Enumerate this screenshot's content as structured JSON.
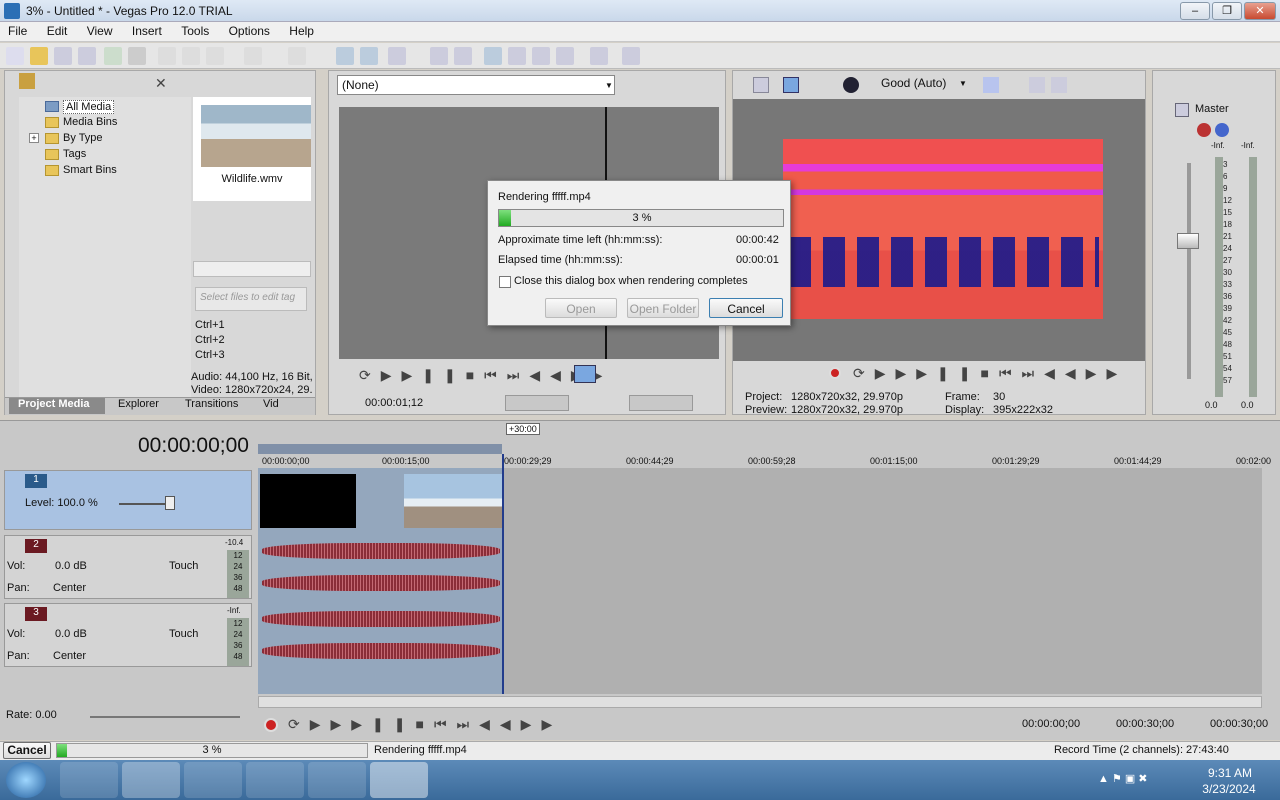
{
  "window": {
    "title": "3% - Untitled * - Vegas Pro 12.0 TRIAL",
    "min": "–",
    "max": "❐",
    "close": "✕"
  },
  "menu": [
    "File",
    "Edit",
    "View",
    "Insert",
    "Tools",
    "Options",
    "Help"
  ],
  "explorer": {
    "tree": [
      "All Media",
      "Media Bins",
      "By Type",
      "Tags",
      "Smart Bins"
    ],
    "expander": "+",
    "thumb_label": "Wildlife.wmv",
    "search_placeholder": "Select files to edit tag",
    "shortcuts": [
      "Ctrl+1",
      "Ctrl+2",
      "Ctrl+3"
    ],
    "info_audio": "Audio: 44,100 Hz, 16 Bit,",
    "info_video": "Video: 1280x720x24, 29.",
    "tabs": [
      "Project Media",
      "Explorer",
      "Transitions",
      "Vid"
    ]
  },
  "trimmer": {
    "select_value": "(None)",
    "timecode": "00:00:01;12"
  },
  "preview": {
    "quality": "Good (Auto)",
    "project_label": "Project:",
    "project_value": "1280x720x32, 29.970p",
    "preview_label": "Preview:",
    "preview_value": "1280x720x32, 29.970p",
    "frame_label": "Frame:",
    "frame_value": "30",
    "display_label": "Display:",
    "display_value": "395x222x32"
  },
  "mixer": {
    "title": "Master",
    "inf_left": "-Inf.",
    "inf_right": "-Inf.",
    "scale": [
      "3",
      "6",
      "9",
      "12",
      "15",
      "18",
      "21",
      "24",
      "27",
      "30",
      "33",
      "36",
      "39",
      "42",
      "45",
      "48",
      "51",
      "54",
      "57"
    ],
    "bottom_left": "0.0",
    "bottom_right": "0.0"
  },
  "render_dialog": {
    "title": "Rendering fffff.mp4",
    "progress_text": "3 %",
    "progress": 0.03,
    "approx_label": "Approximate time left (hh:mm:ss):",
    "approx_value": "00:00:42",
    "elapsed_label": "Elapsed time (hh:mm:ss):",
    "elapsed_value": "00:00:01",
    "close_checkbox_label": "Close this dialog box when rendering completes",
    "open_label": "Open",
    "open_folder_label": "Open Folder",
    "cancel_label": "Cancel"
  },
  "timeline": {
    "timecode": "00:00:00;00",
    "loop_badge": "+30:00",
    "ruler": [
      "00:00:00;00",
      "00:00:15;00",
      "00:00:29;29",
      "00:00:44;29",
      "00:00:59;28",
      "00:01:15;00",
      "00:01:29;29",
      "00:01:44;29",
      "00:02:00"
    ],
    "tracks": [
      {
        "num": "1",
        "level_label": "Level: 100.0 %"
      },
      {
        "num": "2",
        "vol_label": "Vol:",
        "vol_value": "0.0 dB",
        "pan_label": "Pan:",
        "pan_value": "Center",
        "mode": "Touch",
        "meter_top": "-10.4",
        "meter_scale": [
          "12",
          "24",
          "36",
          "48"
        ]
      },
      {
        "num": "3",
        "vol_label": "Vol:",
        "vol_value": "0.0 dB",
        "pan_label": "Pan:",
        "pan_value": "Center",
        "mode": "Touch",
        "meter_top": "-Inf.",
        "meter_scale": [
          "12",
          "24",
          "36",
          "48"
        ]
      }
    ],
    "rate": "Rate: 0.00",
    "sel_start": "00:00:00;00",
    "sel_end": "00:00:30;00",
    "sel_len": "00:00:30;00"
  },
  "status": {
    "cancel_label": "Cancel",
    "progress_text": "3 %",
    "progress": 0.03,
    "message": "Rendering fffff.mp4",
    "record_time": "Record Time (2 channels): 27:43:40"
  },
  "taskbar": {
    "time": "9:31 AM",
    "date": "3/23/2024"
  }
}
